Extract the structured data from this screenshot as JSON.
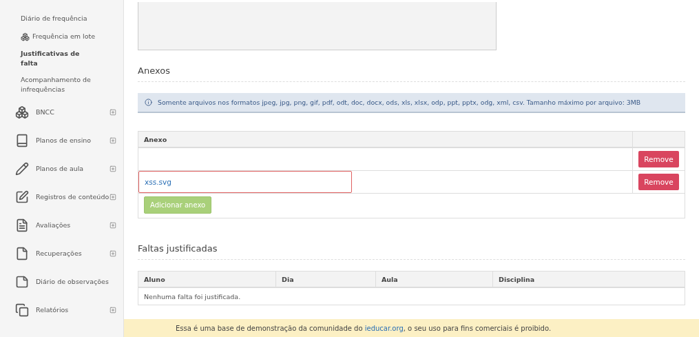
{
  "sidebar": {
    "items": [
      {
        "label": "Diário de frequência",
        "kind": "sub",
        "selected": false
      },
      {
        "label": "Frequência em lote",
        "kind": "sub_icon",
        "selected": false
      },
      {
        "label": "Justificativas de falta",
        "kind": "sub",
        "selected": true
      },
      {
        "label": "Acompanhamento de infrequências",
        "kind": "sub",
        "selected": false
      },
      {
        "label": "BNCC",
        "kind": "main",
        "expandable": true
      },
      {
        "label": "Planos de ensino",
        "kind": "main",
        "expandable": true
      },
      {
        "label": "Planos de aula",
        "kind": "main",
        "expandable": true
      },
      {
        "label": "Registros de conteúdo",
        "kind": "main",
        "expandable": true
      },
      {
        "label": "Avaliações",
        "kind": "main",
        "expandable": true
      },
      {
        "label": "Recuperações",
        "kind": "main",
        "expandable": true
      },
      {
        "label": "Diário de observações",
        "kind": "main",
        "expandable": false
      },
      {
        "label": "Relatórios",
        "kind": "main",
        "expandable": true
      }
    ]
  },
  "attachments": {
    "title": "Anexos",
    "info": "Somente arquivos nos formatos jpeg, jpg, png, gif, pdf, odt, doc, docx, ods, xls, xlsx, odp, ppt, pptx, odg, xml, csv. Tamanho máximo por arquivo: 3MB",
    "column": "Anexo",
    "rows": [
      {
        "file": "",
        "button": "Remove",
        "highlighted": false
      },
      {
        "file": "xss.svg",
        "button": "Remove",
        "highlighted": true
      }
    ],
    "add_button": "Adicionar anexo"
  },
  "absences": {
    "title": "Faltas justificadas",
    "columns": [
      "Aluno",
      "Dia",
      "Aula",
      "Disciplina"
    ],
    "empty": "Nenhuma falta foi justificada."
  },
  "footer": {
    "before": "Essa é uma base de demonstração da comunidade do",
    "link": "ieducar.org",
    "after": ", o seu uso para fins comerciais é proibido."
  }
}
